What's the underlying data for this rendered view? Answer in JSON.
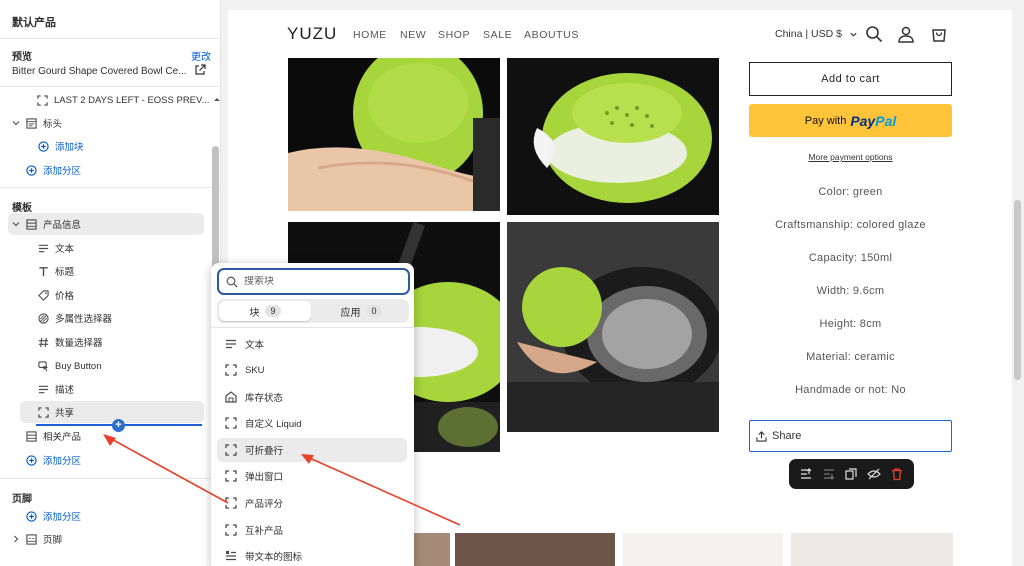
{
  "sidebar": {
    "title": "默认产品",
    "preview_label": "预览",
    "change_link": "更改",
    "product_name": "Bitter Gourd Shape Covered Bowl Ce...",
    "header_group": {
      "top_item": "LAST 2 DAYS LEFT - EOSS PREV...",
      "header_label": "标头",
      "add_block": "添加块",
      "add_section": "添加分区"
    },
    "template_label": "模板",
    "product_info": "产品信息",
    "blocks": [
      "文本",
      "标题",
      "价格",
      "多属性选择器",
      "数量选择器",
      "Buy Button",
      "描述",
      "共享"
    ],
    "related_products": "相关产品",
    "template_add_section": "添加分区",
    "footer_group_label": "页脚",
    "footer_add_section": "添加分区",
    "footer_label": "页脚"
  },
  "popup": {
    "search_placeholder": "搜索块",
    "tabs": [
      {
        "label": "块",
        "count": "9"
      },
      {
        "label": "应用",
        "count": "0"
      }
    ],
    "items": [
      "文本",
      "SKU",
      "库存状态",
      "自定义 Liquid",
      "可折叠行",
      "弹出窗口",
      "产品评分",
      "互补产品",
      "带文本的图标"
    ]
  },
  "store": {
    "logo": "YUZU",
    "nav": [
      "HOME",
      "NEW",
      "SHOP",
      "SALE",
      "ABOUTUS"
    ],
    "currency": "China | USD $",
    "add_to_cart": "Add to cart",
    "paypal_prefix": "Pay with",
    "paypal_pay": "Pay",
    "paypal_pal": "Pal",
    "more_payment": "More payment options",
    "specs": [
      "Color: green",
      "Craftsmanship: colored glaze",
      "Capacity: 150ml",
      "Width: 9.6cm",
      "Height: 8cm",
      "Material: ceramic",
      "Handmade or not: No"
    ],
    "share": "Share",
    "related_heading_fragment": "e"
  },
  "colors": {
    "accent_blue": "#005bd3",
    "paypal_yellow": "#ffc439",
    "annotation_red": "#e8412c",
    "gourd_green": "#a6d63c"
  }
}
